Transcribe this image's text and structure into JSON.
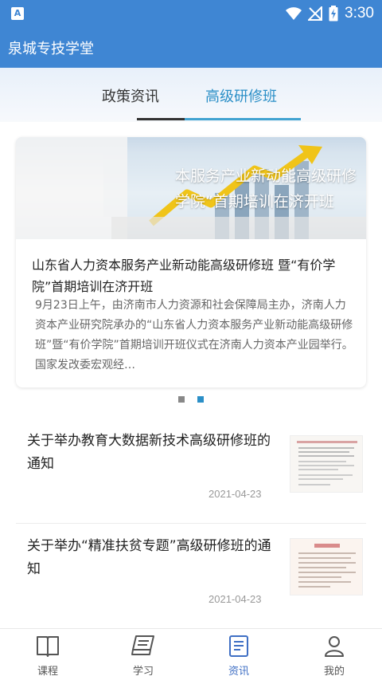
{
  "status_bar": {
    "app_badge": "A",
    "time": "3:30"
  },
  "app_bar": {
    "title": "泉城专技学堂"
  },
  "tabs": [
    {
      "label": "政策资讯"
    },
    {
      "label": "高级研修班"
    }
  ],
  "banner": {
    "image_text_line1": "本服务产业新动能高级研修",
    "image_text_line2": "学院”首期培训在济开班",
    "title": "山东省人力资本服务产业新动能高级研修班 暨“有价学院”首期培训在济开班",
    "summary": "9月23日上午，由济南市人力资源和社会保障局主办，济南人力资本产业研究院承办的“山东省人力资本服务产业新动能高级研修班”暨“有价学院”首期培训开班仪式在济南人力资本产业园举行。国家发改委宏观经…",
    "dots_total": 2,
    "dots_active": 2
  },
  "news": [
    {
      "title": "关于举办教育大数据新技术高级研修班的通知",
      "date": "2021-04-23"
    },
    {
      "title": "关于举办“精准扶贫专题”高级研修班的通知",
      "date": "2021-04-23"
    }
  ],
  "bottom_nav": [
    {
      "label": "课程",
      "icon": "book-icon"
    },
    {
      "label": "学习",
      "icon": "study-icon"
    },
    {
      "label": "资讯",
      "icon": "news-icon",
      "active": true
    },
    {
      "label": "我的",
      "icon": "profile-icon"
    }
  ],
  "colors": {
    "primary": "#3f86d3",
    "tab_active": "#2b8fc7",
    "nav_active": "#3f6fc4"
  }
}
